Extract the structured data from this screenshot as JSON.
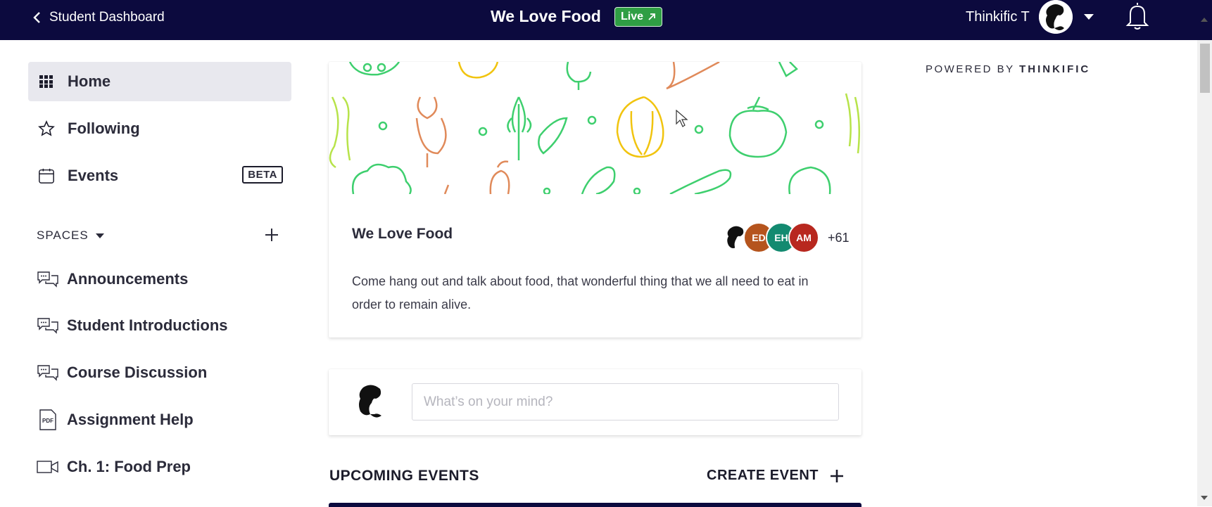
{
  "header": {
    "back_label": "Student Dashboard",
    "site_title": "We Love Food",
    "live_label": "Live",
    "user_name": "Thinkific T"
  },
  "sidebar": {
    "items": [
      {
        "label": "Home",
        "icon": "grid-icon"
      },
      {
        "label": "Following",
        "icon": "star-icon"
      },
      {
        "label": "Events",
        "icon": "calendar-icon",
        "badge": "BETA"
      }
    ],
    "spaces_header": "SPACES",
    "spaces": [
      {
        "label": "Announcements",
        "icon": "chat-bubbles-icon"
      },
      {
        "label": "Student Introductions",
        "icon": "chat-bubbles-icon"
      },
      {
        "label": "Course Discussion",
        "icon": "chat-bubbles-icon"
      },
      {
        "label": "Assignment Help",
        "icon": "pdf-icon"
      },
      {
        "label": "Ch. 1: Food Prep",
        "icon": "video-icon"
      }
    ]
  },
  "community": {
    "name": "We Love Food",
    "members": [
      {
        "initials": "ED",
        "color": "#b5541d"
      },
      {
        "initials": "EH",
        "color": "#138a70"
      },
      {
        "initials": "AM",
        "color": "#b8281f"
      }
    ],
    "member_count": "+61",
    "description": "Come hang out and talk about food, that wonderful thing that we all need to eat in order to remain alive."
  },
  "composer": {
    "placeholder": "What’s on your mind?"
  },
  "events": {
    "title": "UPCOMING EVENTS",
    "create_label": "CREATE EVENT"
  },
  "powered_by": {
    "prefix": "POWERED BY",
    "brand": "THINKIFIC"
  },
  "colors": {
    "topbar": "#0c0a3e",
    "live": "#2f9e44",
    "active_nav": "#e8e8ee"
  }
}
